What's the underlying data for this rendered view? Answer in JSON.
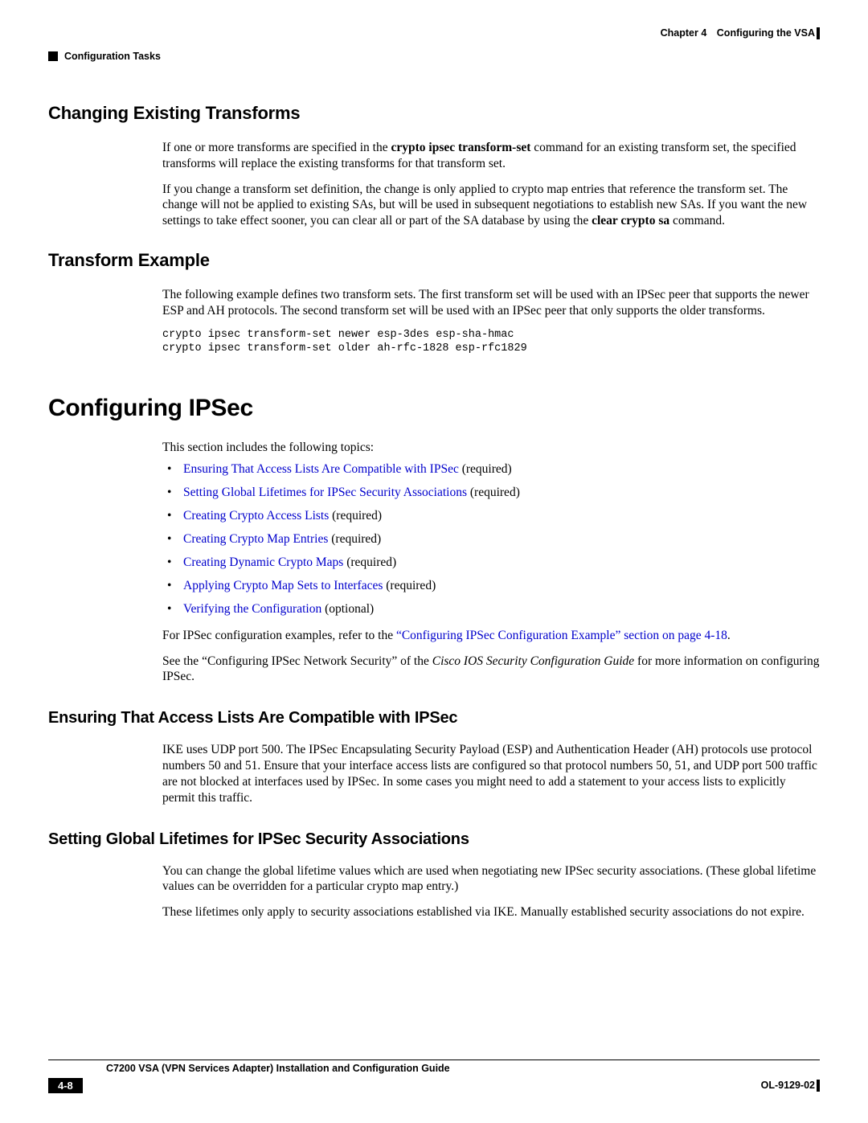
{
  "header": {
    "chapter_label": "Chapter 4 Configuring the VSA",
    "section_label": "Configuration Tasks"
  },
  "sections": {
    "changing_transforms": {
      "title": "Changing Existing Transforms",
      "p1_a": "If one or more transforms are specified in the ",
      "p1_cmd": "crypto ipsec transform-set",
      "p1_b": " command for an existing transform set, the specified transforms will replace the existing transforms for that transform set.",
      "p2_a": "If you change a transform set definition, the change is only applied to crypto map entries that reference the transform set. The change will not be applied to existing SAs, but will be used in subsequent negotiations to establish new SAs. If you want the new settings to take effect sooner, you can clear all or part of the SA database by using the ",
      "p2_cmd": "clear crypto sa",
      "p2_b": " command."
    },
    "transform_example": {
      "title": "Transform Example",
      "p1": "The following example defines two transform sets. The first transform set will be used with an IPSec peer that supports the newer ESP and AH protocols. The second transform set will be used with an IPSec peer that only supports the older transforms.",
      "code": "crypto ipsec transform-set newer esp-3des esp-sha-hmac\ncrypto ipsec transform-set older ah-rfc-1828 esp-rfc1829"
    },
    "configuring_ipsec": {
      "title": "Configuring IPSec",
      "intro": "This section includes the following topics:",
      "topics": [
        {
          "link": "Ensuring That Access Lists Are Compatible with IPSec",
          "suffix": " (required)"
        },
        {
          "link": "Setting Global Lifetimes for IPSec Security Associations",
          "suffix": " (required)"
        },
        {
          "link": "Creating Crypto Access Lists",
          "suffix": " (required)"
        },
        {
          "link": "Creating Crypto Map Entries",
          "suffix": " (required)"
        },
        {
          "link": "Creating Dynamic Crypto Maps",
          "suffix": " (required)"
        },
        {
          "link": "Applying Crypto Map Sets to Interfaces",
          "suffix": " (required)"
        },
        {
          "link": "Verifying the Configuration",
          "suffix": " (optional)"
        }
      ],
      "ref_a": "For IPSec configuration examples, refer to the ",
      "ref_link": "“Configuring IPSec Configuration Example” section on page 4-18",
      "ref_b": ".",
      "see_a": "See the “Configuring IPSec Network Security” of the ",
      "see_italic": "Cisco IOS Security Configuration Guide",
      "see_b": " for more information on configuring IPSec."
    },
    "ensuring_acl": {
      "title": "Ensuring That Access Lists Are Compatible with IPSec",
      "p1": "IKE uses UDP port 500. The IPSec Encapsulating Security Payload (ESP) and Authentication Header (AH) protocols use protocol numbers 50 and 51. Ensure that your interface access lists are configured so that protocol numbers 50, 51, and UDP port 500 traffic are not blocked at interfaces used by IPSec. In some cases you might need to add a statement to your access lists to explicitly permit this traffic."
    },
    "global_lifetimes": {
      "title": "Setting Global Lifetimes for IPSec Security Associations",
      "p1": "You can change the global lifetime values which are used when negotiating new IPSec security associations. (These global lifetime values can be overridden for a particular crypto map entry.)",
      "p2": "These lifetimes only apply to security associations established via IKE. Manually established security associations do not expire."
    }
  },
  "footer": {
    "guide_title": "C7200 VSA (VPN Services Adapter) Installation and Configuration Guide",
    "page_number": "4-8",
    "doc_id": "OL-9129-02"
  }
}
